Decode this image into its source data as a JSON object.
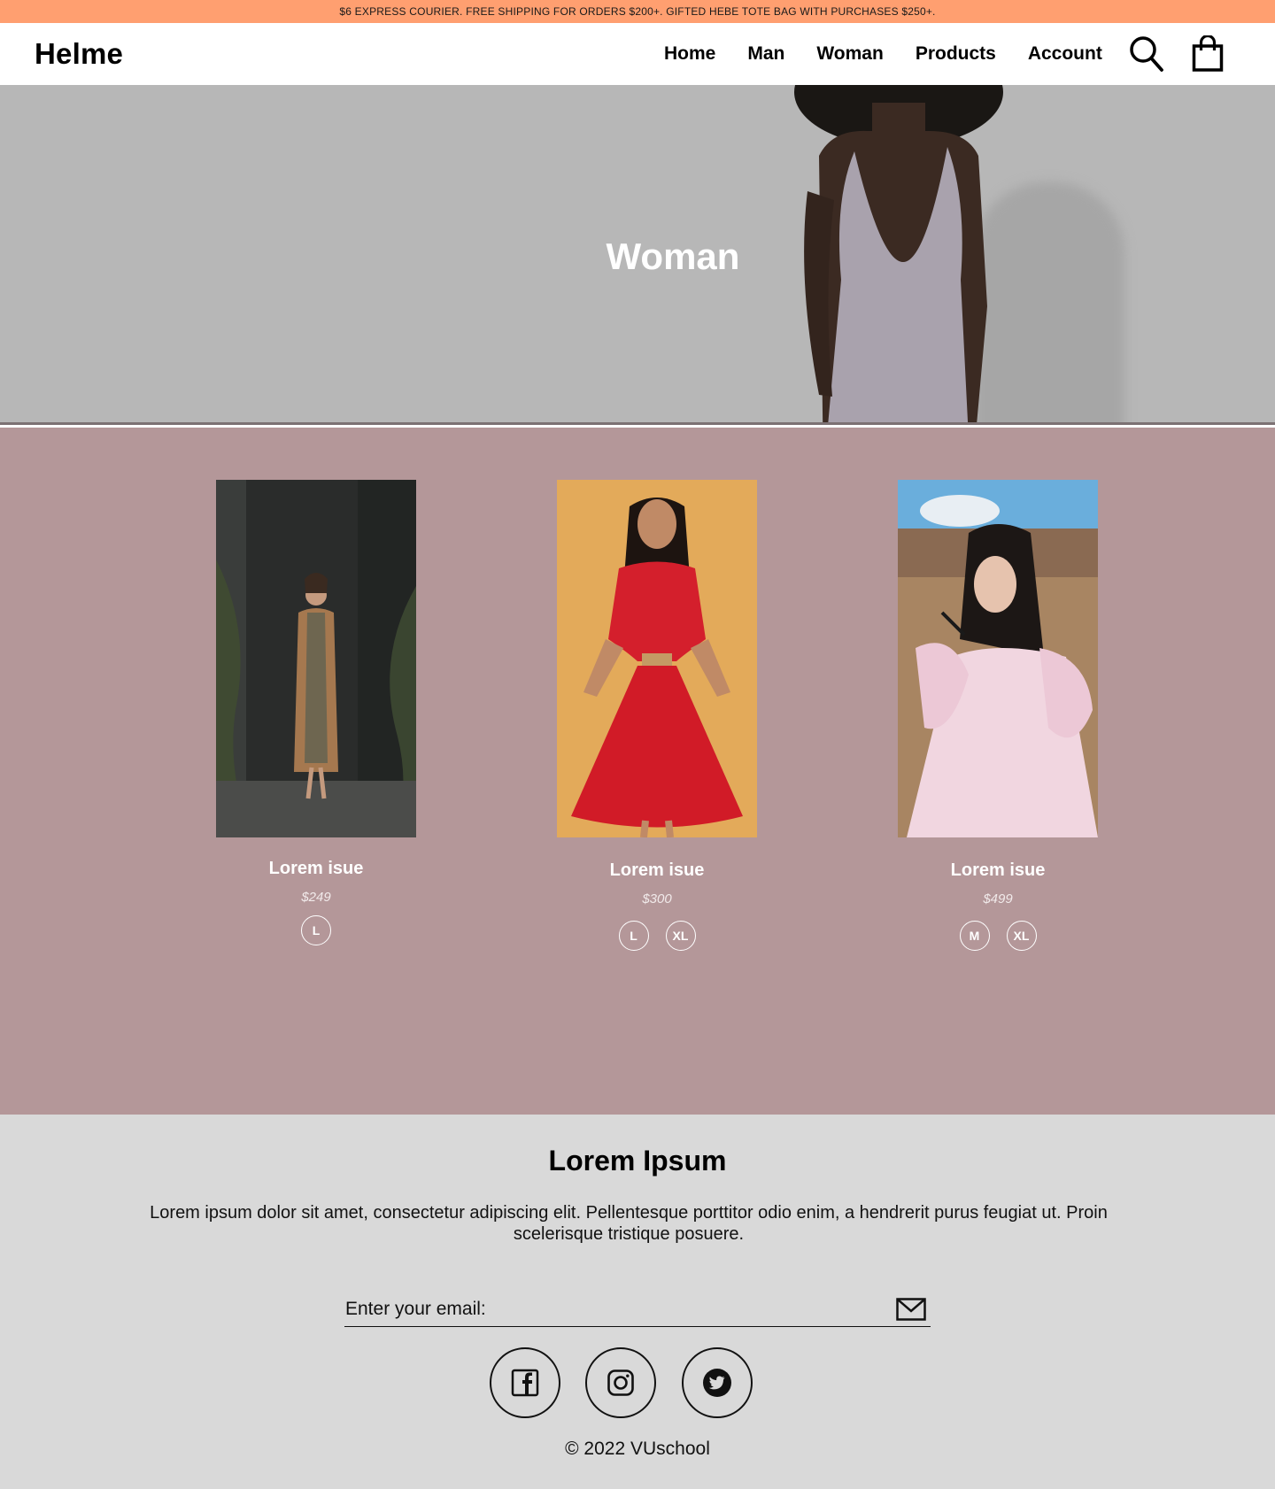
{
  "announcement": "$6 EXPRESS COURIER. FREE SHIPPING FOR ORDERS $200+. GIFTED HEBE TOTE BAG WITH PURCHASES $250+.",
  "header": {
    "logo": "Helme",
    "nav": [
      "Home",
      "Man",
      "Woman",
      "Products",
      "Account"
    ],
    "icons": [
      "search-icon",
      "shopping-bag-icon"
    ]
  },
  "hero": {
    "title": "Woman"
  },
  "products": [
    {
      "title": "Lorem isue",
      "price": "$249",
      "sizes": [
        "L"
      ]
    },
    {
      "title": "Lorem isue",
      "price": "$300",
      "sizes": [
        "L",
        "XL"
      ]
    },
    {
      "title": "Lorem isue",
      "price": "$499",
      "sizes": [
        "M",
        "XL"
      ]
    }
  ],
  "footer": {
    "title": "Lorem Ipsum",
    "text": "Lorem ipsum dolor sit amet, consectetur adipiscing elit. Pellentesque porttitor odio enim, a hendrerit purus feugiat ut. Proin scelerisque tristique posuere.",
    "email_placeholder": "Enter your email:",
    "social_icons": [
      "facebook-icon",
      "instagram-icon",
      "twitter-icon"
    ],
    "copyright": "© 2022 VUschool"
  },
  "colors": {
    "announcement_bg": "#ff9f70",
    "hero_bg": "#b7b7b7",
    "products_bg": "#b49799",
    "footer_bg": "#d9d9d9"
  }
}
